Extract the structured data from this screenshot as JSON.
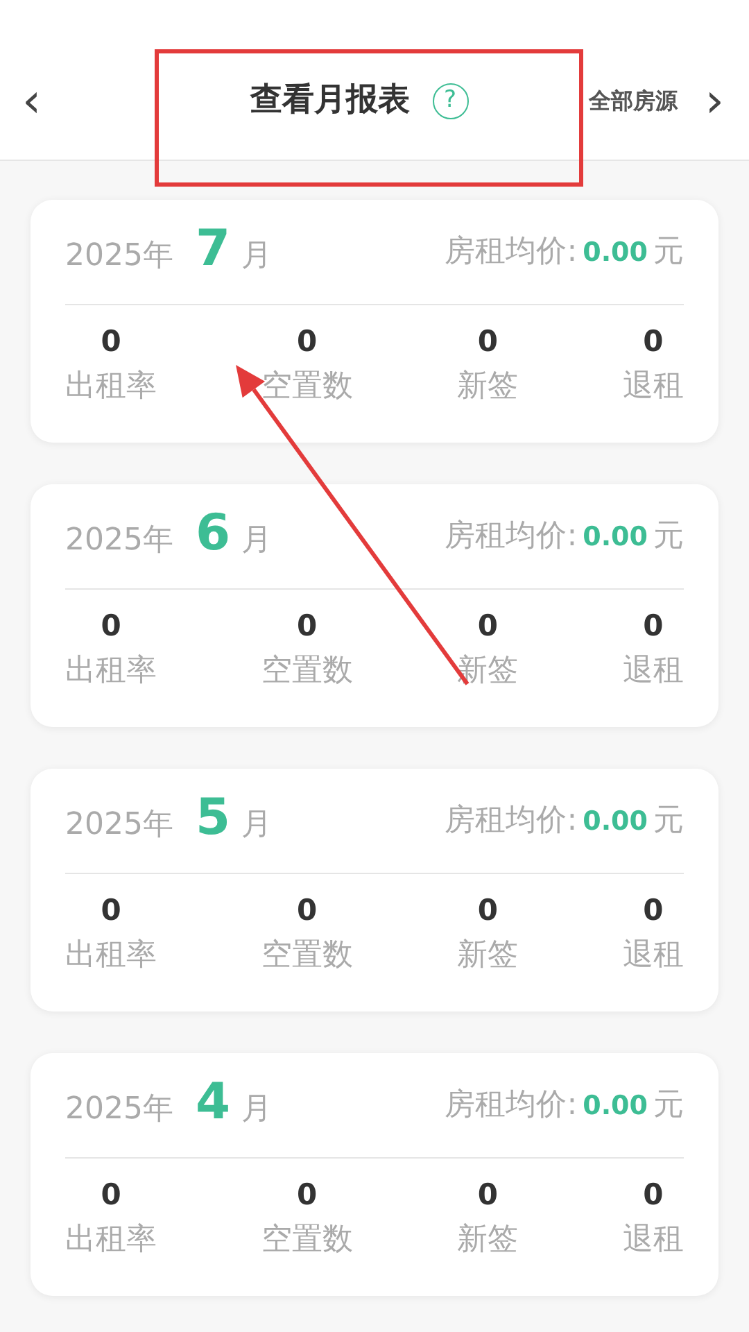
{
  "header": {
    "back": "‹",
    "title": "查看月报表",
    "help": "?",
    "filter": "全部房源",
    "forward": "›"
  },
  "reports": [
    {
      "year": "2025年",
      "month": "7",
      "month_unit": "月",
      "price_label": "房租均价:",
      "price": "0.00",
      "price_unit": "元",
      "stats": [
        {
          "value": "0",
          "label": "出租率"
        },
        {
          "value": "0",
          "label": "空置数"
        },
        {
          "value": "0",
          "label": "新签"
        },
        {
          "value": "0",
          "label": "退租"
        }
      ]
    },
    {
      "year": "2025年",
      "month": "6",
      "month_unit": "月",
      "price_label": "房租均价:",
      "price": "0.00",
      "price_unit": "元",
      "stats": [
        {
          "value": "0",
          "label": "出租率"
        },
        {
          "value": "0",
          "label": "空置数"
        },
        {
          "value": "0",
          "label": "新签"
        },
        {
          "value": "0",
          "label": "退租"
        }
      ]
    },
    {
      "year": "2025年",
      "month": "5",
      "month_unit": "月",
      "price_label": "房租均价:",
      "price": "0.00",
      "price_unit": "元",
      "stats": [
        {
          "value": "0",
          "label": "出租率"
        },
        {
          "value": "0",
          "label": "空置数"
        },
        {
          "value": "0",
          "label": "新签"
        },
        {
          "value": "0",
          "label": "退租"
        }
      ]
    },
    {
      "year": "2025年",
      "month": "4",
      "month_unit": "月",
      "price_label": "房租均价:",
      "price": "0.00",
      "price_unit": "元",
      "stats": [
        {
          "value": "0",
          "label": "出租率"
        },
        {
          "value": "0",
          "label": "空置数"
        },
        {
          "value": "0",
          "label": "新签"
        },
        {
          "value": "0",
          "label": "退租"
        }
      ]
    }
  ],
  "annotations": [
    {
      "kind": "box"
    },
    {
      "kind": "arrow"
    }
  ]
}
